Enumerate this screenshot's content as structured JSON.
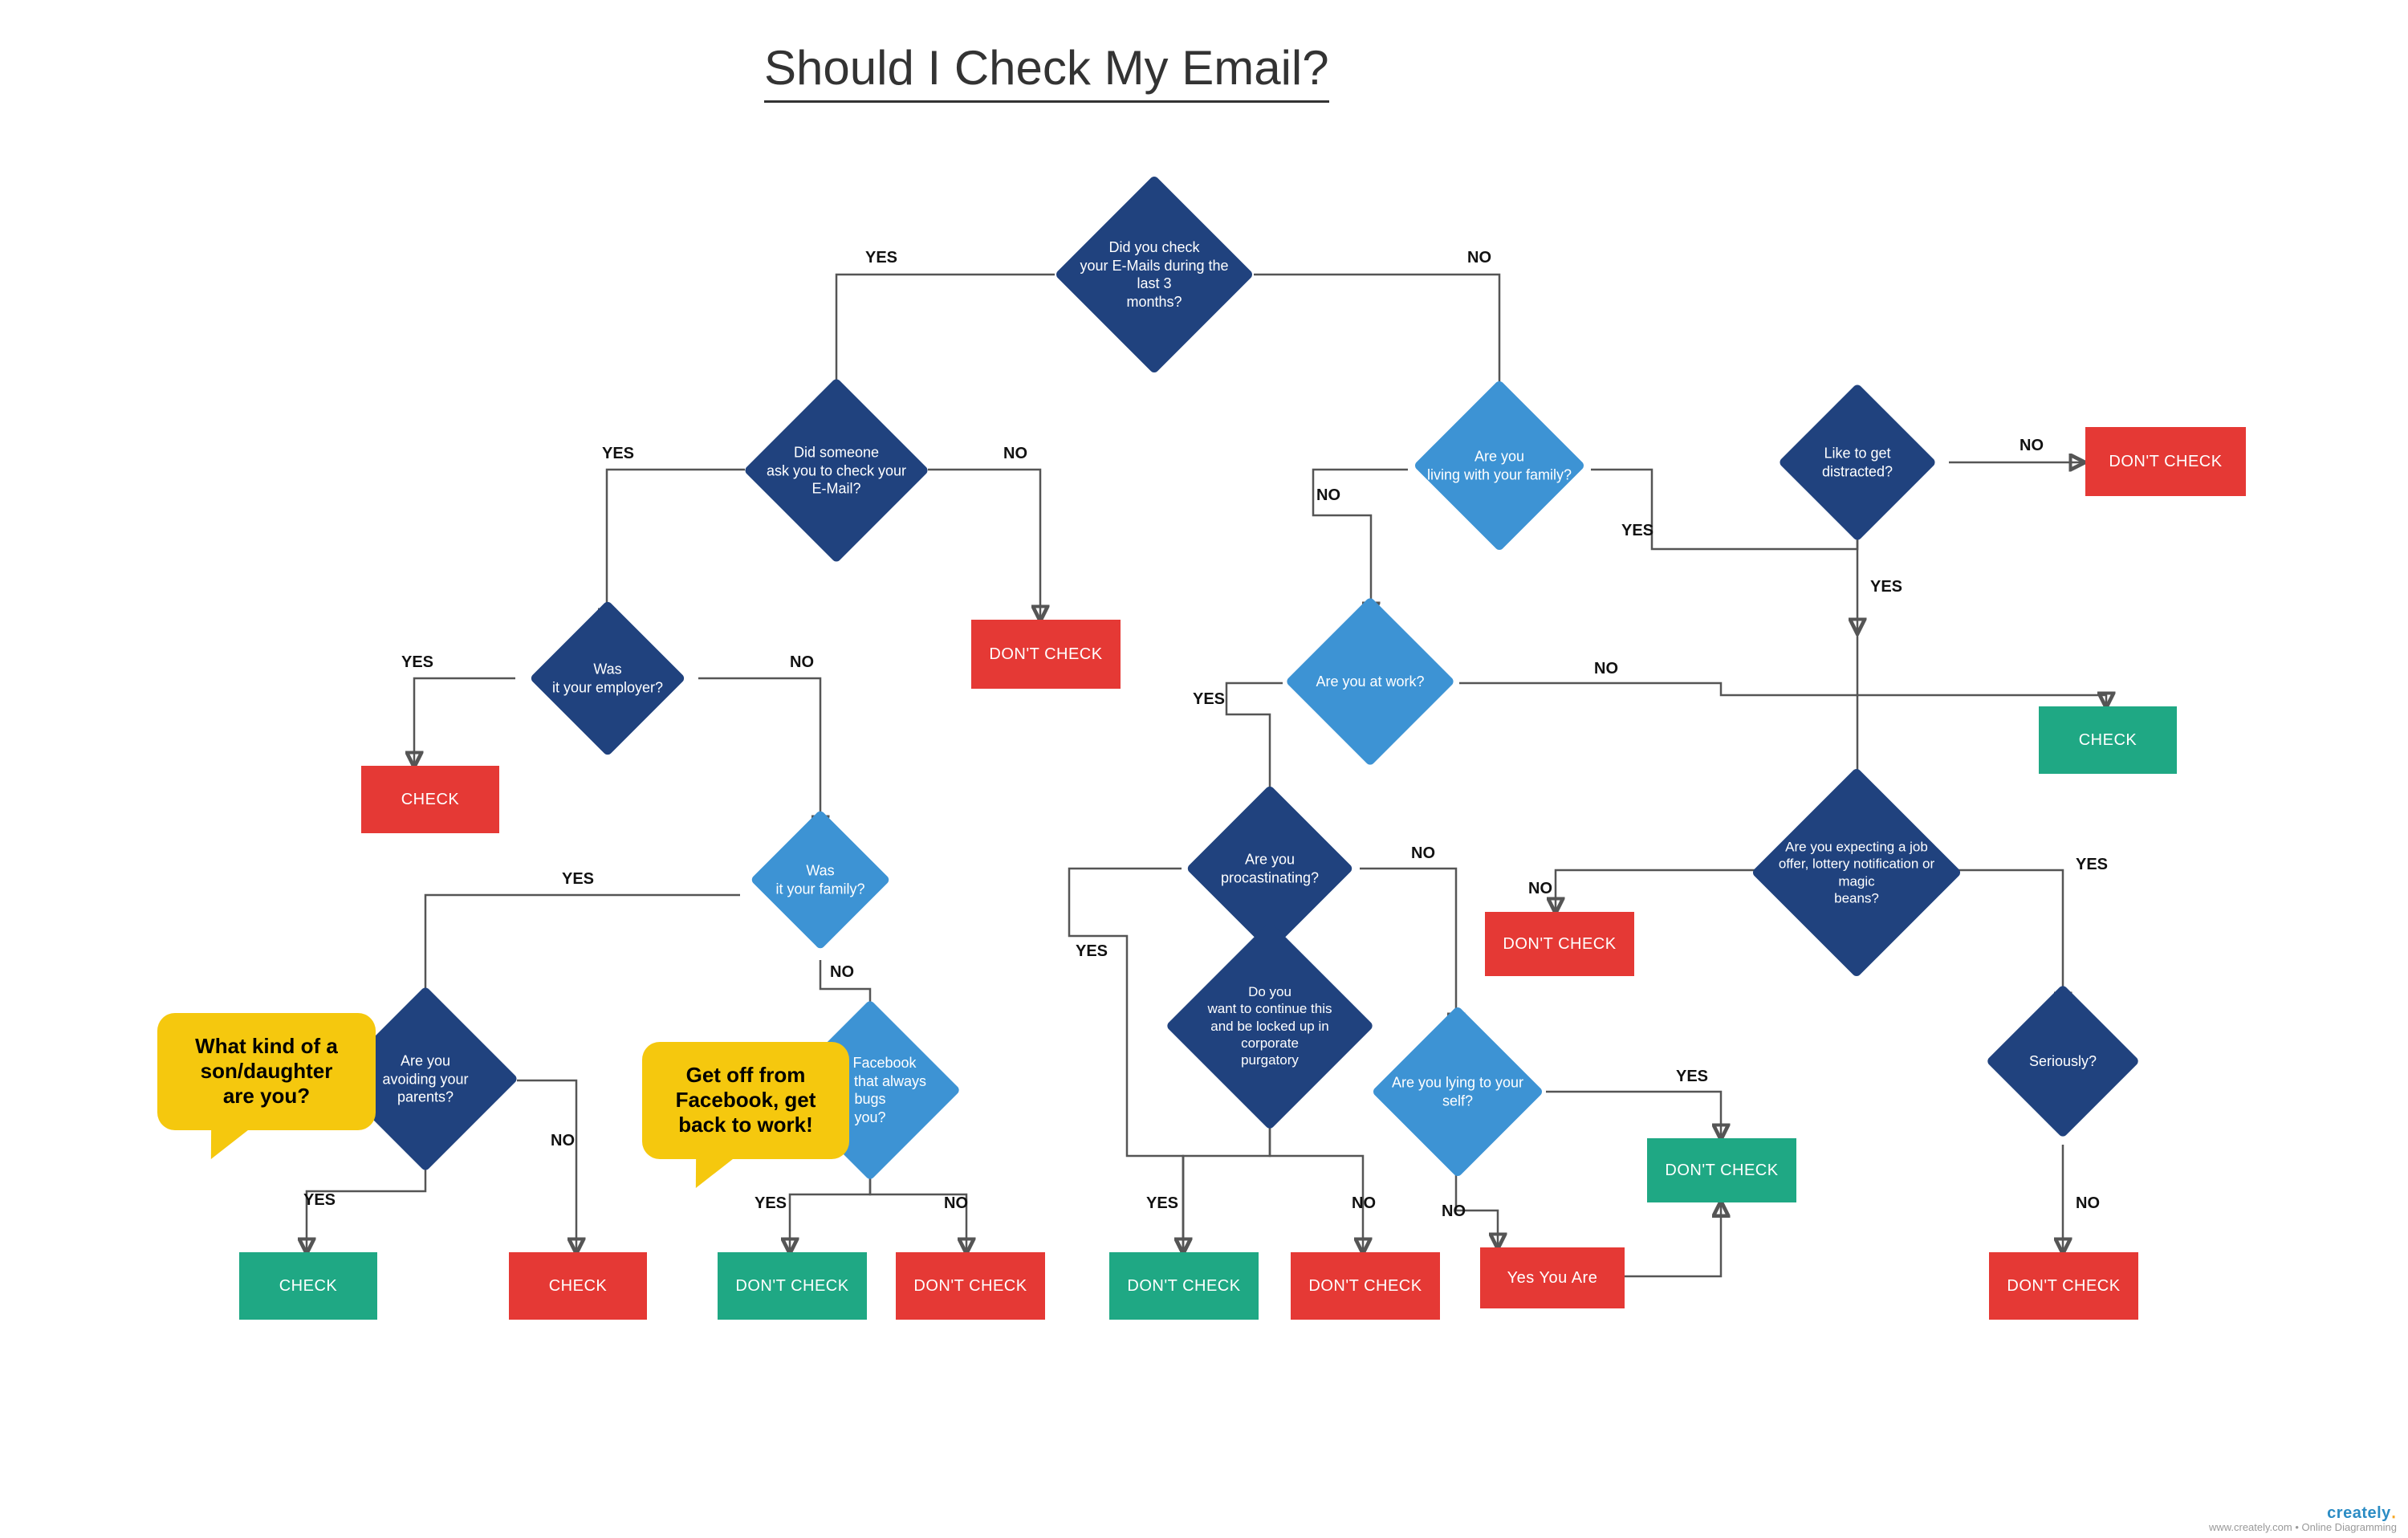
{
  "title": "Should I Check My Email?",
  "labels": {
    "yes": "YES",
    "no": "NO"
  },
  "nodes": {
    "q1": {
      "text": "Did you check\nyour E-Mails during  the last 3\nmonths?"
    },
    "q2": {
      "text": "Did someone\nask you to  check your\nE-Mail?"
    },
    "q3": {
      "text": "Was\nit your employer?"
    },
    "q4": {
      "text": "Was\nit your  family?"
    },
    "q5": {
      "text": "Are you\nliving with  your family?"
    },
    "q6": {
      "text": "Like to get distracted?"
    },
    "q7": {
      "text": "Are you at  work?"
    },
    "q8": {
      "text": "Are you procastinating?"
    },
    "q9": {
      "text": "Do you\nwant to continue this\nand be locked  up in corporate\npurgatory"
    },
    "q10": {
      "text": "The Facebook\nfriend that  always bugs\nyou?"
    },
    "q11": {
      "text": "Are you\navoiding your  parents?"
    },
    "q12": {
      "text": "Are you lying to  your self?"
    },
    "q13": {
      "text": "Are you expecting a job\noffer, lottery notification  or magic\nbeans?"
    },
    "q14": {
      "text": "Seriously?"
    },
    "r_check_employer": {
      "text": "CHECK"
    },
    "r_dont_no_ask": {
      "text": "DON'T CHECK"
    },
    "r_dont_distract_no": {
      "text": "DON'T CHECK"
    },
    "r_check_distract_yes": {
      "text": "CHECK"
    },
    "r_check_avoid_yes": {
      "text": "CHECK"
    },
    "r_check_avoid_no": {
      "text": "CHECK"
    },
    "r_dont_fb_yes": {
      "text": "DON'T CHECK"
    },
    "r_dont_fb_no": {
      "text": "DON'T CHECK"
    },
    "r_dont_purg_yes": {
      "text": "DON'T CHECK"
    },
    "r_dont_purg_no": {
      "text": "DON'T CHECK"
    },
    "r_lying_yes": {
      "text": "DON'T CHECK"
    },
    "r_lying_no": {
      "text": "Yes You Are"
    },
    "r_dont_expect_no": {
      "text": "DON'T CHECK"
    },
    "r_dont_seriously": {
      "text": "DON'T CHECK"
    }
  },
  "callouts": {
    "son": "What kind of a\nson/daughter\nare you?",
    "fb": "Get off from\nFacebook, get\nback to work!"
  },
  "footer": {
    "brand": "creately",
    "sub": "www.creately.com • Online Diagramming"
  }
}
